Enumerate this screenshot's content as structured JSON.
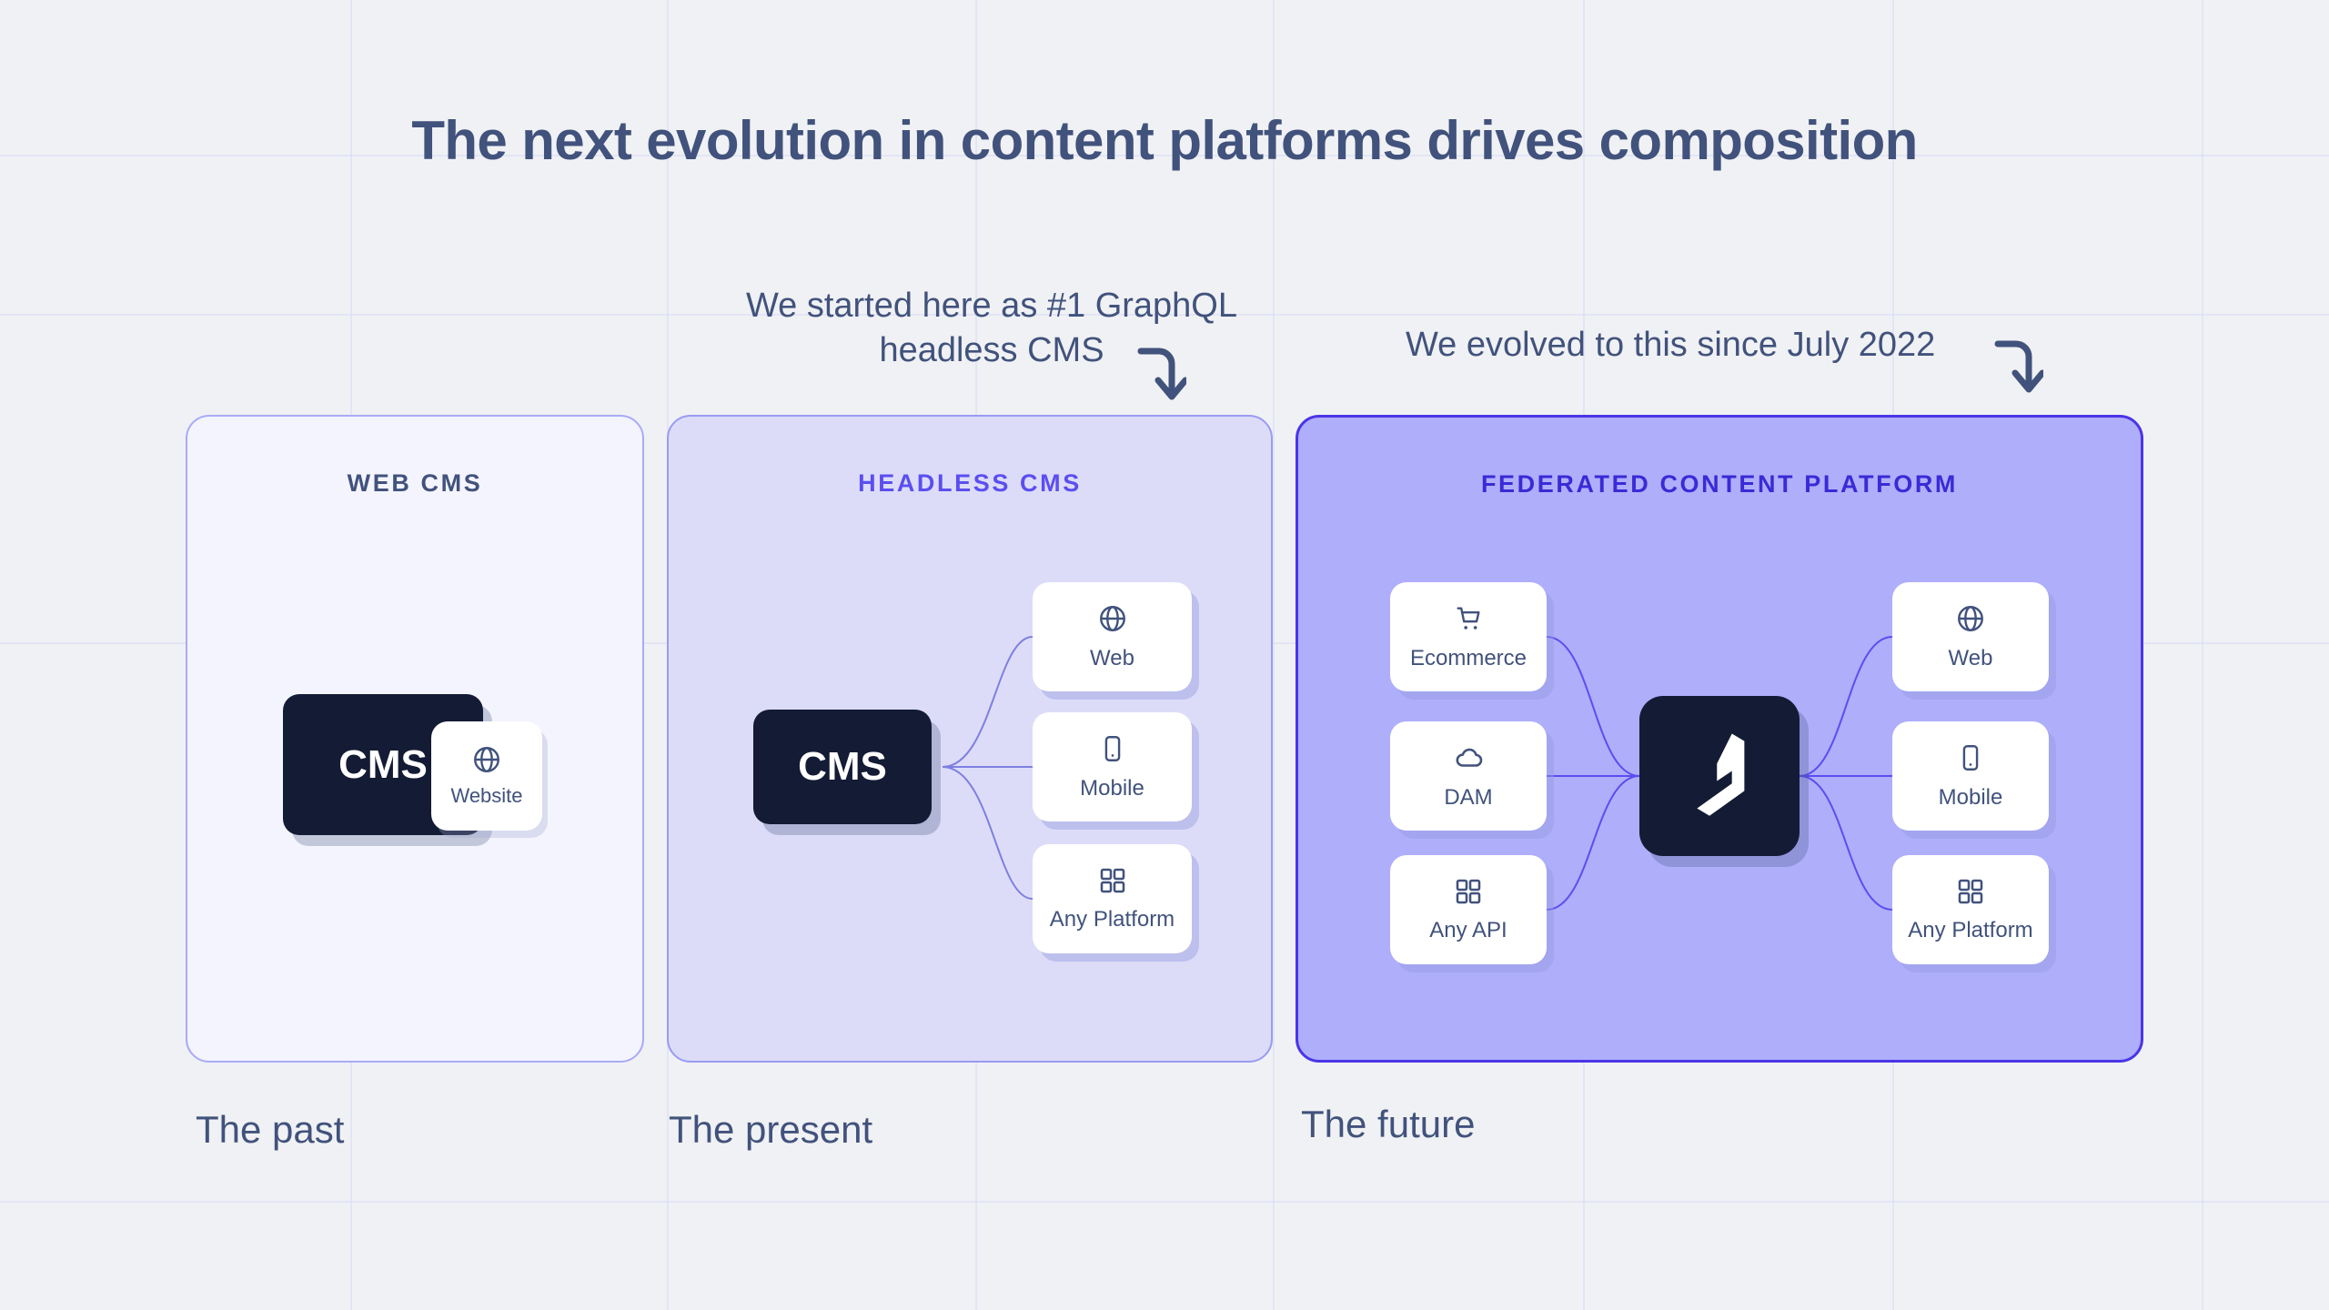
{
  "page": {
    "title": "The next evolution in content platforms drives composition",
    "background_color": "#f0f1f4"
  },
  "annotations": [
    {
      "id": "started-here",
      "text": "We started  here as #1 GraphQL headless CMS",
      "arrow": "curved-down-arrow"
    },
    {
      "id": "evolved-here",
      "text": "We evolved to this since July 2022",
      "arrow": "curved-down-arrow"
    }
  ],
  "panels": [
    {
      "id": "past",
      "title": "WEB CMS",
      "caption": "The past",
      "fill": "#f4f4fe",
      "border": "#a9abf7",
      "title_color": "#41527c",
      "core": {
        "label": "CMS"
      },
      "chip": {
        "label": "Website",
        "icon": "globe-icon"
      },
      "outputs": []
    },
    {
      "id": "present",
      "title": "HEADLESS CMS",
      "caption": "The present",
      "fill": "#dcdcf8",
      "border": "#9a9bf3",
      "title_color": "#5b4ef0",
      "core": {
        "label": "CMS"
      },
      "outputs": [
        {
          "label": "Web",
          "icon": "globe-icon"
        },
        {
          "label": "Mobile",
          "icon": "mobile-icon"
        },
        {
          "label": "Any Platform",
          "icon": "grid-icon"
        }
      ]
    },
    {
      "id": "future",
      "title": "FEDERATED CONTENT PLATFORM",
      "caption": "The future",
      "fill": "#aeaefb",
      "border": "#4b35e8",
      "title_color": "#3a2ad6",
      "core": {
        "label": "",
        "icon": "hygraph-logo-icon"
      },
      "inputs": [
        {
          "label": "Ecommerce",
          "icon": "shopping-cart-icon"
        },
        {
          "label": "DAM",
          "icon": "cloud-icon"
        },
        {
          "label": "Any API",
          "icon": "grid-icon"
        }
      ],
      "outputs": [
        {
          "label": "Web",
          "icon": "globe-icon"
        },
        {
          "label": "Mobile",
          "icon": "mobile-icon"
        },
        {
          "label": "Any Platform",
          "icon": "grid-icon"
        }
      ]
    }
  ],
  "colors": {
    "text_dark": "#41527c",
    "accent_purple": "#5b4ef0",
    "deep_indigo": "#3a2ad6",
    "dark_box": "#141b35",
    "card_white": "#ffffff"
  }
}
